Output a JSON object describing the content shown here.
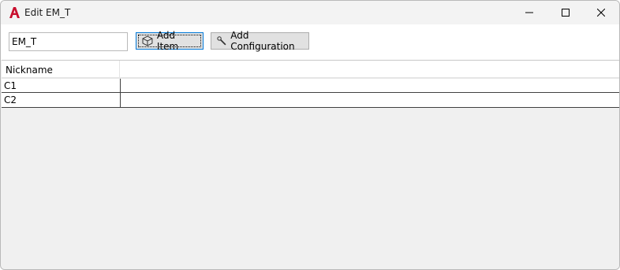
{
  "window": {
    "title": "Edit EM_T",
    "app_icon": "autocad-a-icon",
    "accent_color": "#c8102e"
  },
  "caption_buttons": {
    "minimize": "minimize-icon",
    "maximize": "maximize-icon",
    "close": "close-icon"
  },
  "toolbar": {
    "name_value": "EM_T",
    "add_item_label": "Add Item",
    "add_item_icon": "cube-icon",
    "add_configuration_label": "Add Configuration",
    "add_configuration_icon": "wrench-icon"
  },
  "grid": {
    "columns": [
      "Nickname",
      ""
    ],
    "rows": [
      [
        "C1",
        ""
      ],
      [
        "C2",
        ""
      ]
    ]
  }
}
